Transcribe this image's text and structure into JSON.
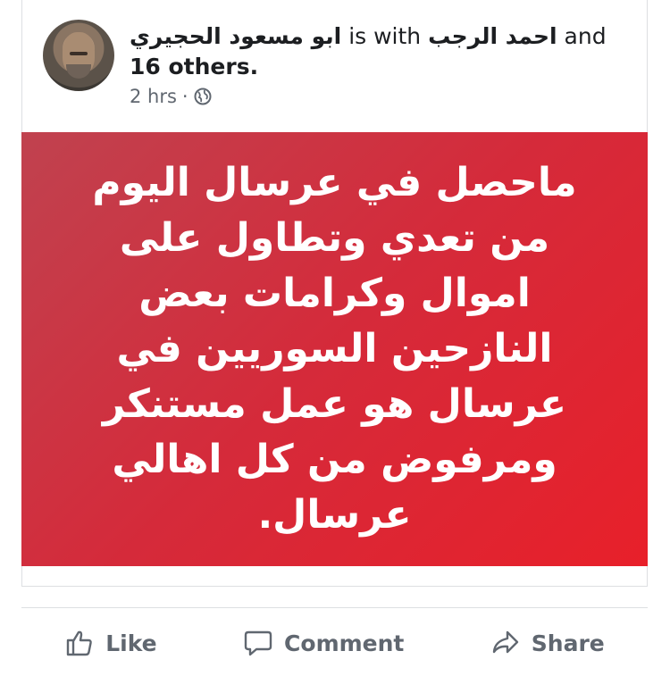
{
  "post": {
    "author_name": "ابو مسعود الحجيري",
    "with_text": "is with",
    "tagged_name": "احمد الرجب",
    "and_text": "and",
    "others_text": "16 others.",
    "timestamp": "2 hrs",
    "separator": "·",
    "privacy_icon": "globe-icon",
    "body_text": "ماحصل في عرسال اليوم من تعدي وتطاول على اموال وكرامات بعض النازحين السوريين في عرسال هو عمل مستنكر ومرفوض من كل اهالي عرسال.",
    "banner_color_start": "#c0424f",
    "banner_color_end": "#e8202a"
  },
  "actions": {
    "like_label": "Like",
    "comment_label": "Comment",
    "share_label": "Share",
    "icon_color": "#606770"
  }
}
